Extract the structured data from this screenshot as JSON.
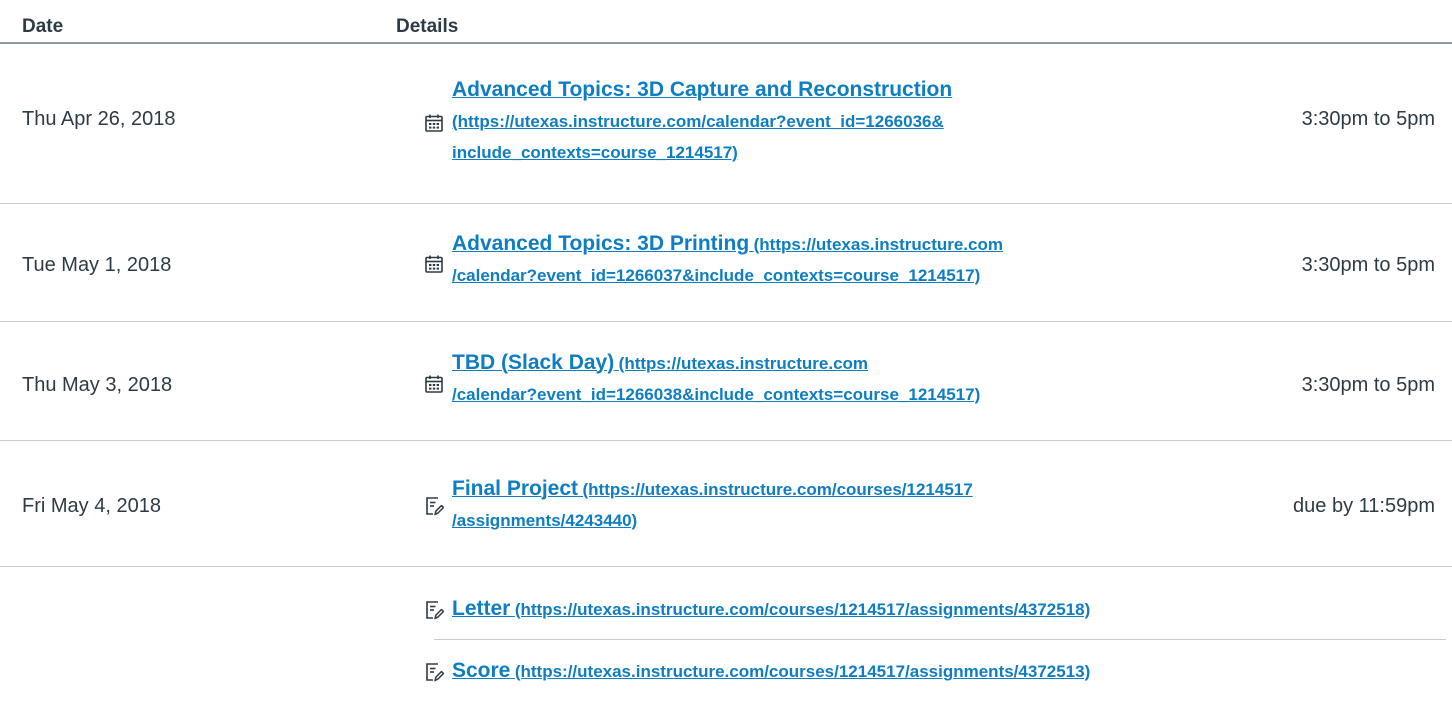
{
  "header": {
    "date_label": "Date",
    "details_label": "Details"
  },
  "rows": [
    {
      "date": "Thu Apr 26, 2018",
      "icon": "calendar-icon",
      "title": "Advanced Topics: 3D Capture and Reconstruction",
      "url_line1": "(https://utexas.instructure.com/calendar?event_id=1266036&",
      "url_line2": "include_contexts=course_1214517)",
      "time": "3:30pm to 5pm"
    },
    {
      "date": "Tue May 1, 2018",
      "icon": "calendar-icon",
      "title": "Advanced Topics: 3D Printing",
      "url_line1": "(https://utexas.instructure.com",
      "url_line2": "/calendar?event_id=1266037&include_contexts=course_1214517)",
      "time": "3:30pm to 5pm"
    },
    {
      "date": "Thu May 3, 2018",
      "icon": "calendar-icon",
      "title": "TBD (Slack Day)",
      "url_line1": "(https://utexas.instructure.com",
      "url_line2": "/calendar?event_id=1266038&include_contexts=course_1214517)",
      "time": "3:30pm to 5pm"
    },
    {
      "date": "Fri May 4, 2018",
      "icon": "assignment-icon",
      "title": "Final Project",
      "url_line1": "(https://utexas.instructure.com/courses/1214517",
      "url_line2": "/assignments/4243440)",
      "time": "due by 11:59pm"
    }
  ],
  "undated": [
    {
      "icon": "assignment-icon",
      "title": "Letter",
      "url": "(https://utexas.instructure.com/courses/1214517/assignments/4372518)"
    },
    {
      "icon": "assignment-icon",
      "title": "Score",
      "url": "(https://utexas.instructure.com/courses/1214517/assignments/4372513)"
    }
  ],
  "colors": {
    "link": "#0f7dc2",
    "text": "#2d3b45",
    "divider": "#c7cdd1",
    "header_rule": "#8c9aa5"
  }
}
